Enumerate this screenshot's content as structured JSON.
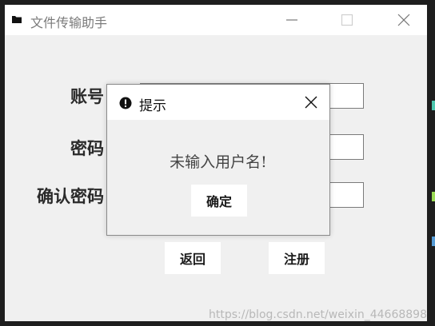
{
  "window": {
    "title": "文件传输助手",
    "icon": "folder-icon",
    "controls": [
      "minimize-icon",
      "maximize-icon",
      "close-icon"
    ]
  },
  "form": {
    "account_label": "账号",
    "password_label": "密码",
    "confirm_label": "确认密码",
    "account_value": "",
    "password_value": "",
    "confirm_value": ""
  },
  "buttons": {
    "back": "返回",
    "register": "注册"
  },
  "dialog": {
    "title": "提示",
    "icon": "exclamation-icon",
    "message": "未输入用户名!",
    "ok": "确定"
  },
  "watermark": "https://blog.csdn.net/weixin_44668898",
  "colors": {
    "window_bg": "#f0f0f0",
    "titlebar_bg": "#ffffff",
    "desktop_bg": "#1e1e1e",
    "button_bg": "#ffffff"
  }
}
